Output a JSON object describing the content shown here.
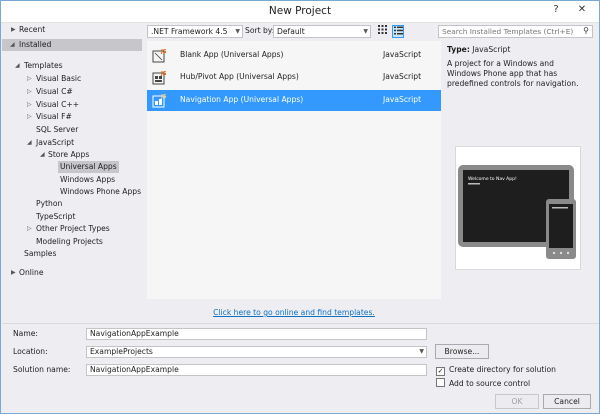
{
  "window": {
    "title": "New Project",
    "help_glyph": "?",
    "close_glyph": "✕"
  },
  "tree": {
    "recent": "Recent",
    "installed": "Installed",
    "templates": "Templates",
    "visual_basic": "Visual Basic",
    "visual_csharp": "Visual C#",
    "visual_cpp": "Visual C++",
    "visual_fsharp": "Visual F#",
    "sql_server": "SQL Server",
    "javascript": "JavaScript",
    "store_apps": "Store Apps",
    "universal_apps": "Universal Apps",
    "windows_apps": "Windows Apps",
    "windows_phone_apps": "Windows Phone Apps",
    "python": "Python",
    "typescript": "TypeScript",
    "other_project_types": "Other Project Types",
    "modeling_projects": "Modeling Projects",
    "samples": "Samples",
    "online": "Online"
  },
  "toolbar": {
    "framework": ".NET Framework 4.5",
    "sort_label": "Sort by:",
    "sort_value": "Default",
    "search_placeholder": "Search Installed Templates (Ctrl+E)"
  },
  "templates": [
    {
      "name": "Blank App (Universal Apps)",
      "language": "JavaScript",
      "icon": "blank-app-icon"
    },
    {
      "name": "Hub/Pivot App (Universal Apps)",
      "language": "JavaScript",
      "icon": "hub-app-icon"
    },
    {
      "name": "Navigation App (Universal Apps)",
      "language": "JavaScript",
      "icon": "navigation-app-icon"
    }
  ],
  "online_link": "Click here to go online and find templates.",
  "details": {
    "type_label": "Type:",
    "type_value": "JavaScript",
    "description": "A project for a Windows and Windows Phone app that has predefined controls for navigation.",
    "preview_text": "Welcome to Nav App!"
  },
  "form": {
    "name_label": "Name:",
    "name_value": "NavigationAppExample",
    "location_label": "Location:",
    "location_value": "ExampleProjects",
    "solution_label": "Solution name:",
    "solution_value": "NavigationAppExample",
    "browse": "Browse...",
    "create_dir": "Create directory for solution",
    "create_dir_checked": true,
    "source_control": "Add to source control",
    "source_control_checked": false,
    "ok": "OK",
    "cancel": "Cancel"
  },
  "colors": {
    "accent": "#3399ff",
    "link": "#0e70c0",
    "selected_tree": "#c6c6cb"
  }
}
